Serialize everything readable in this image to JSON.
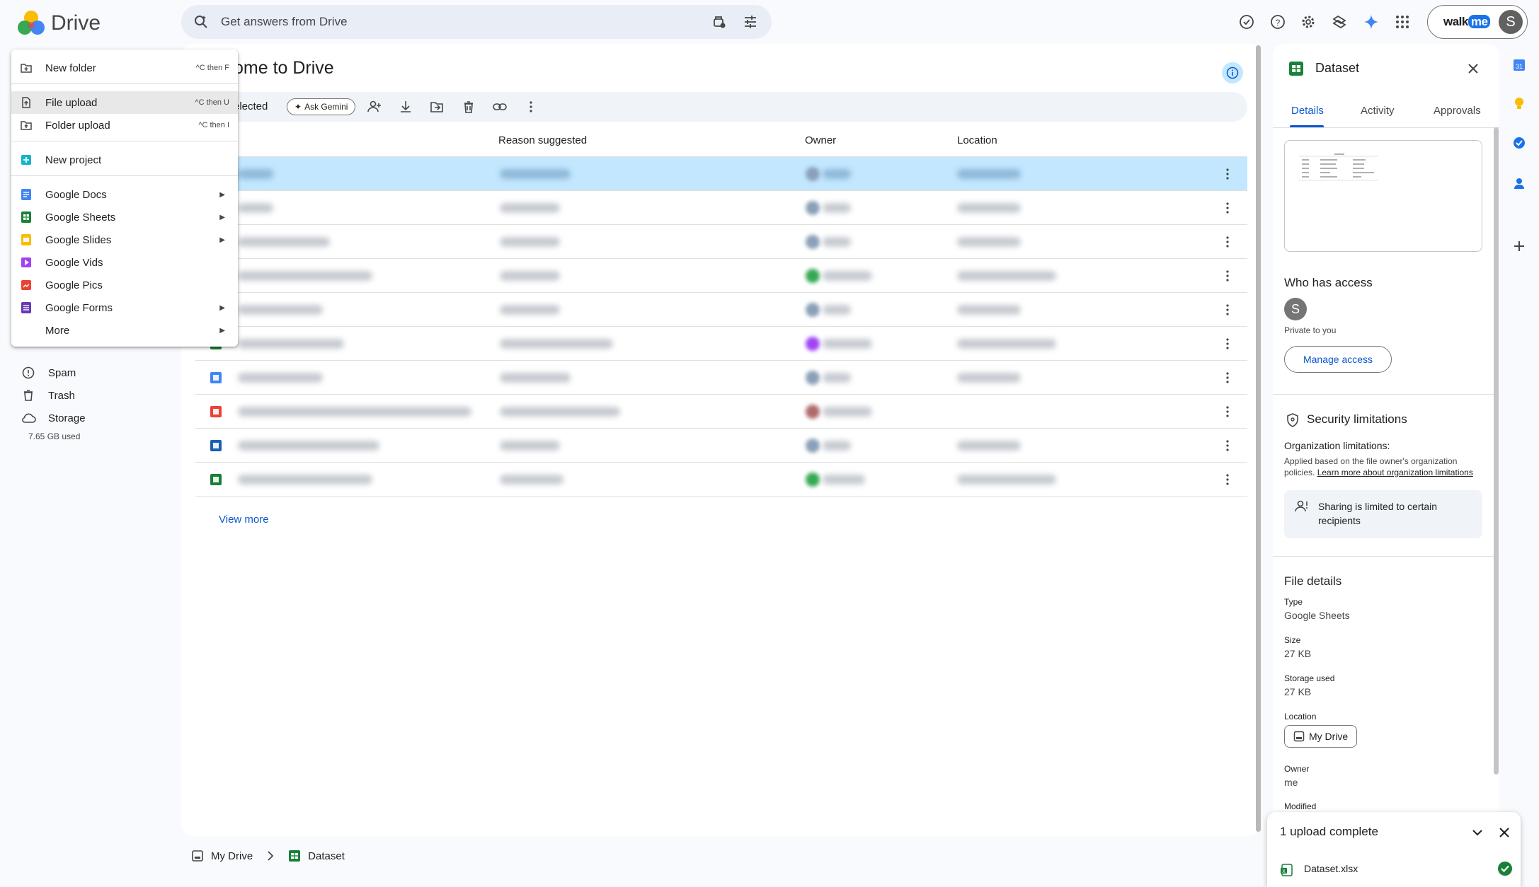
{
  "app": {
    "title": "Drive"
  },
  "search": {
    "placeholder": "Get answers from Drive"
  },
  "account": {
    "brand_prefix": "walk",
    "brand_suffix": "me",
    "avatar_letter": "S"
  },
  "sidebar": {
    "items": [
      {
        "label": "Spam",
        "icon": "spam-icon"
      },
      {
        "label": "Trash",
        "icon": "trash-icon"
      },
      {
        "label": "Storage",
        "icon": "cloud-icon"
      }
    ],
    "storage_used": "7.65 GB used"
  },
  "new_menu": {
    "items": [
      {
        "label": "New folder",
        "shortcut": "^C then F",
        "icon": "new-folder-icon"
      },
      {
        "label": "File upload",
        "shortcut": "^C then U",
        "icon": "file-upload-icon",
        "highlighted": true
      },
      {
        "label": "Folder upload",
        "shortcut": "^C then I",
        "icon": "folder-upload-icon"
      },
      {
        "label": "New project",
        "icon": "new-project-icon"
      },
      {
        "label": "Google Docs",
        "icon": "docs-icon",
        "submenu": true
      },
      {
        "label": "Google Sheets",
        "icon": "sheets-icon",
        "submenu": true
      },
      {
        "label": "Google Slides",
        "icon": "slides-icon",
        "submenu": true
      },
      {
        "label": "Google Vids",
        "icon": "vids-icon"
      },
      {
        "label": "Google Pics",
        "icon": "pics-icon"
      },
      {
        "label": "Google Forms",
        "icon": "forms-icon",
        "submenu": true
      },
      {
        "label": "More",
        "submenu": true
      }
    ]
  },
  "main": {
    "title": "ome to Drive",
    "selection_text": "elected",
    "ask_gemini": "Ask Gemini",
    "columns": {
      "reason": "Reason suggested",
      "owner": "Owner",
      "location": "Location"
    },
    "view_more": "View more",
    "rows_count_note": ""
  },
  "breadcrumb": {
    "root": "My Drive",
    "current": "Dataset"
  },
  "details": {
    "file_name": "Dataset",
    "tabs": [
      "Details",
      "Activity",
      "Approvals"
    ],
    "who_has_access": "Who has access",
    "access_avatar": "S",
    "private_text": "Private to you",
    "manage_access": "Manage access",
    "security_title": "Security limitations",
    "org_limitations": "Organization limitations:",
    "org_text": "Applied based on the file owner's organization policies.",
    "org_link": "Learn more about organization limitations",
    "sharing_limited": "Sharing is limited to certain recipients",
    "file_details_title": "File details",
    "type_label": "Type",
    "type_value": "Google Sheets",
    "size_label": "Size",
    "size_value": "27 KB",
    "storage_label": "Storage used",
    "storage_value": "27 KB",
    "location_label": "Location",
    "location_value": "My Drive",
    "owner_label": "Owner",
    "owner_value": "me",
    "modified_label": "Modified"
  },
  "upload_toast": {
    "title": "1 upload complete",
    "file": "Dataset.xlsx"
  },
  "colors": {
    "accent": "#0b57d0",
    "selected_row": "#c2e7ff",
    "sheets_green": "#188038"
  }
}
